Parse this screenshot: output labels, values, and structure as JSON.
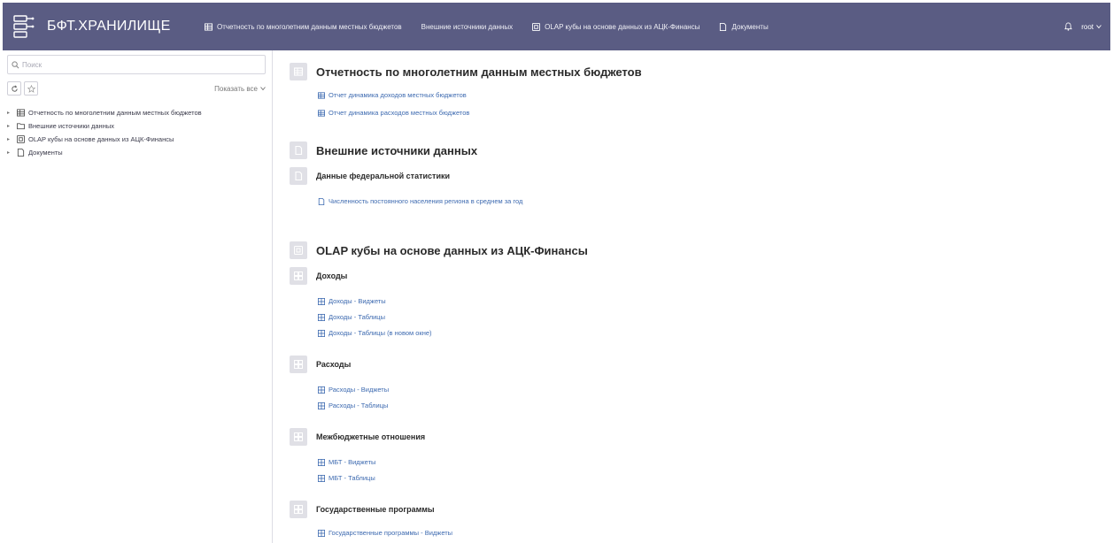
{
  "app": {
    "title": "БФТ.ХРАНИЛИЩЕ"
  },
  "colors": {
    "header_bg": "#5a5c83",
    "link": "#3d6ab0",
    "badge_bg": "#e0e0e6"
  },
  "nav": [
    {
      "label": "Отчетность по многолетним данным местных бюджетов",
      "icon": "table-icon"
    },
    {
      "label": "Внешние источники данных",
      "icon": "none"
    },
    {
      "label": "OLAP кубы на основе данных из АЦК-Финансы",
      "icon": "cube-icon"
    },
    {
      "label": "Документы",
      "icon": "document-icon"
    }
  ],
  "user": {
    "name": "root"
  },
  "sidebar": {
    "search_placeholder": "Поиск",
    "show_all": "Показать все",
    "tree": [
      {
        "label": "Отчетность по многолетним данным местных бюджетов",
        "icon": "table-icon"
      },
      {
        "label": "Внешние источники данных",
        "icon": "folder-icon"
      },
      {
        "label": "OLAP кубы на основе данных из АЦК-Финансы",
        "icon": "cube-icon"
      },
      {
        "label": "Документы",
        "icon": "document-icon"
      }
    ]
  },
  "main": {
    "reports": {
      "title": "Отчетность по многолетним данным местных бюджетов",
      "links": [
        "Отчет динамика доходов местных бюджетов",
        "Отчет динамика расходов местных бюджетов"
      ]
    },
    "external": {
      "title": "Внешние источники данных",
      "sub": {
        "title": "Данные федеральной статистики",
        "links": [
          "Численность постоянного населения региона в среднем за год"
        ]
      }
    },
    "olap": {
      "title": "OLAP кубы на основе данных из АЦК-Финансы",
      "groups": [
        {
          "title": "Доходы",
          "links": [
            "Доходы - Виджеты",
            "Доходы - Таблицы",
            "Доходы - Таблицы (в новом окне)"
          ]
        },
        {
          "title": "Расходы",
          "links": [
            "Расходы - Виджеты",
            "Расходы - Таблицы"
          ]
        },
        {
          "title": "Межбюджетные отношения",
          "links": [
            "МБТ - Виджеты",
            "МБТ - Таблицы"
          ]
        },
        {
          "title": "Государственные программы",
          "links": [
            "Государственные программы - Виджеты"
          ]
        }
      ]
    }
  }
}
